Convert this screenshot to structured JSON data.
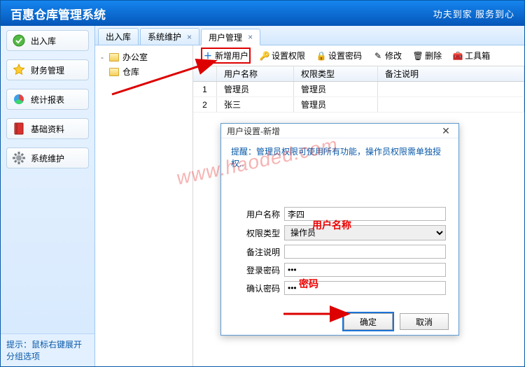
{
  "app": {
    "title": "百惠仓库管理系统",
    "slogan": "功夫到家 服务到心"
  },
  "sidebar": {
    "items": [
      {
        "label": "出入库"
      },
      {
        "label": "财务管理"
      },
      {
        "label": "统计报表"
      },
      {
        "label": "基础资料"
      },
      {
        "label": "系统维护"
      }
    ],
    "footer": "提示：鼠标右键展开分组选项"
  },
  "tabs": [
    {
      "label": "出入库"
    },
    {
      "label": "系统维护"
    },
    {
      "label": "用户管理",
      "active": true
    }
  ],
  "tree": [
    {
      "label": "办公室",
      "expand": "-"
    },
    {
      "label": "仓库",
      "expand": ""
    }
  ],
  "toolbar": [
    {
      "label": "新增用户",
      "highlight": true
    },
    {
      "label": "设置权限"
    },
    {
      "label": "设置密码"
    },
    {
      "label": "修改"
    },
    {
      "label": "删除"
    },
    {
      "label": "工具箱"
    }
  ],
  "table": {
    "cols": [
      "",
      "用户名称",
      "权限类型",
      "备注说明"
    ],
    "rows": [
      {
        "n": "1",
        "name": "管理员",
        "role": "管理员",
        "note": ""
      },
      {
        "n": "2",
        "name": "张三",
        "role": "管理员",
        "note": ""
      }
    ]
  },
  "dialog": {
    "title": "用户设置-新增",
    "hint": "提醒：管理员权限可使用所有功能，操作员权限需单独授权..",
    "fields": {
      "username_label": "用户名称",
      "username_value": "李四",
      "role_label": "权限类型",
      "role_value": "操作员",
      "note_label": "备注说明",
      "note_value": "",
      "pwd_label": "登录密码",
      "pwd_value": "•••",
      "pwd2_label": "确认密码",
      "pwd2_value": "•••"
    },
    "ok": "确定",
    "cancel": "取消"
  },
  "annotations": {
    "username": "用户名称",
    "password": "密码",
    "watermark": "www.haoded.com"
  }
}
